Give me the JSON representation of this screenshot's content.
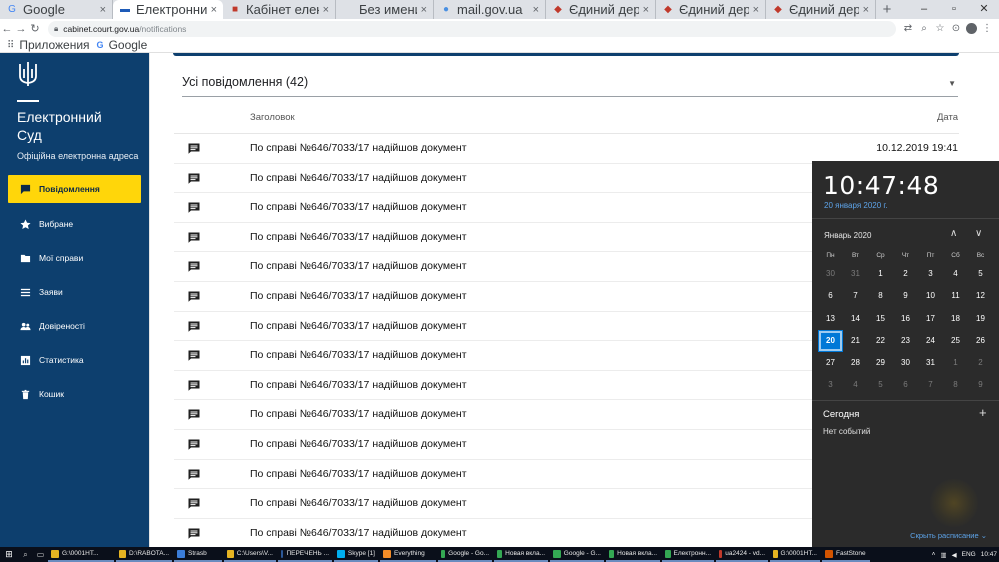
{
  "browser": {
    "tabs": [
      {
        "title": "Google",
        "icon": "google-icon",
        "active": false,
        "width": 113
      },
      {
        "title": "Електронний",
        "icon": "ukraine-flag-icon",
        "active": true,
        "width": 110
      },
      {
        "title": "Кабінет елек",
        "icon": "court-icon",
        "active": false,
        "width": 113
      },
      {
        "title": "Без имени",
        "icon": "blank-icon",
        "active": false,
        "width": 98
      },
      {
        "title": "mail.gov.ua",
        "icon": "mail-icon",
        "active": false,
        "width": 112
      },
      {
        "title": "Єдиний держ",
        "icon": "registry-icon",
        "active": false,
        "width": 110
      },
      {
        "title": "Єдиний держ",
        "icon": "registry-icon",
        "active": false,
        "width": 110
      },
      {
        "title": "Єдиний держ",
        "icon": "registry-icon",
        "active": false,
        "width": 110
      }
    ],
    "new_tab": "+",
    "window_controls": [
      "–",
      "▫",
      "✕"
    ],
    "url_host": "cabinet.court.gov.ua",
    "url_path": "/notifications",
    "bookmarks": [
      {
        "label": "Приложения",
        "icon": "apps-grid-icon"
      },
      {
        "label": "Google",
        "icon": "google-icon"
      }
    ]
  },
  "sidebar": {
    "brand_title_line1": "Електронний",
    "brand_title_line2": "Суд",
    "brand_subtitle": "Офіційна електронна адреса",
    "items": [
      {
        "label": "Повідомлення",
        "icon": "message-icon",
        "active": true
      },
      {
        "label": "Вибране",
        "icon": "star-icon",
        "active": false
      },
      {
        "label": "Мої справи",
        "icon": "folder-icon",
        "active": false
      },
      {
        "label": "Заяви",
        "icon": "list-icon",
        "active": false
      },
      {
        "label": "Довіреності",
        "icon": "people-icon",
        "active": false
      },
      {
        "label": "Статистика",
        "icon": "chart-icon",
        "active": false
      },
      {
        "label": "Кошик",
        "icon": "trash-icon",
        "active": false
      }
    ]
  },
  "main": {
    "filter_label": "Усі повідомлення (42)",
    "col_title": "Заголовок",
    "col_date": "Дата",
    "rows": [
      {
        "title": "По справі №646/7033/17 надійшов документ",
        "date": "10.12.2019 19:41"
      },
      {
        "title": "По справі №646/7033/17 надійшов документ",
        "date": ""
      },
      {
        "title": "По справі №646/7033/17 надійшов документ",
        "date": ""
      },
      {
        "title": "По справі №646/7033/17 надійшов документ",
        "date": ""
      },
      {
        "title": "По справі №646/7033/17 надійшов документ",
        "date": ""
      },
      {
        "title": "По справі №646/7033/17 надійшов документ",
        "date": ""
      },
      {
        "title": "По справі №646/7033/17 надійшов документ",
        "date": ""
      },
      {
        "title": "По справі №646/7033/17 надійшов документ",
        "date": ""
      },
      {
        "title": "По справі №646/7033/17 надійшов документ",
        "date": ""
      },
      {
        "title": "По справі №646/7033/17 надійшов документ",
        "date": ""
      },
      {
        "title": "По справі №646/7033/17 надійшов документ",
        "date": ""
      },
      {
        "title": "По справі №646/7033/17 надійшов документ",
        "date": ""
      },
      {
        "title": "По справі №646/7033/17 надійшов документ",
        "date": ""
      },
      {
        "title": "По справі №646/7033/17 надійшов документ",
        "date": ""
      }
    ]
  },
  "clock": {
    "time": "10:47:48",
    "date": "20 января 2020 г.",
    "month": "Январь 2020",
    "weekdays": [
      "Пн",
      "Вт",
      "Ср",
      "Чт",
      "Пт",
      "Сб",
      "Вс"
    ],
    "weeks": [
      [
        "30",
        "31",
        "1",
        "2",
        "3",
        "4",
        "5"
      ],
      [
        "6",
        "7",
        "8",
        "9",
        "10",
        "11",
        "12"
      ],
      [
        "13",
        "14",
        "15",
        "16",
        "17",
        "18",
        "19"
      ],
      [
        "20",
        "21",
        "22",
        "23",
        "24",
        "25",
        "26"
      ],
      [
        "27",
        "28",
        "29",
        "30",
        "31",
        "1",
        "2"
      ],
      [
        "3",
        "4",
        "5",
        "6",
        "7",
        "8",
        "9"
      ]
    ],
    "dim_flags": [
      [
        1,
        1,
        0,
        0,
        0,
        0,
        0
      ],
      [
        0,
        0,
        0,
        0,
        0,
        0,
        0
      ],
      [
        0,
        0,
        0,
        0,
        0,
        0,
        0
      ],
      [
        0,
        0,
        0,
        0,
        0,
        0,
        0
      ],
      [
        0,
        0,
        0,
        0,
        0,
        1,
        1
      ],
      [
        1,
        1,
        1,
        1,
        1,
        1,
        1
      ]
    ],
    "today_index": [
      3,
      0
    ],
    "today_label": "Сегодня",
    "no_events": "Нет событий",
    "hide_schedule": "Скрыть расписание ⌄"
  },
  "taskbar": {
    "apps": [
      {
        "label": "G:\\0001HT...",
        "color": "#e6b422",
        "width": 66
      },
      {
        "label": "D:\\RABOTA...",
        "color": "#e6b422",
        "width": 56
      },
      {
        "label": "Strasb",
        "color": "#3b7dd8",
        "width": 48
      },
      {
        "label": "C:\\Users\\V...",
        "color": "#e6b422",
        "width": 52
      },
      {
        "label": "ПЕРЕЧЕНЬ ...",
        "color": "#2b5797",
        "width": 54
      },
      {
        "label": "Skype [1]",
        "color": "#00aff0",
        "width": 44
      },
      {
        "label": "Everything",
        "color": "#f28c28",
        "width": 56
      },
      {
        "label": "Google - Go...",
        "color": "#34a853",
        "width": 54
      },
      {
        "label": "Новая вкла...",
        "color": "#34a853",
        "width": 54
      },
      {
        "label": "Google - G...",
        "color": "#34a853",
        "width": 54
      },
      {
        "label": "Новая вкла...",
        "color": "#34a853",
        "width": 54
      },
      {
        "label": "Електронн...",
        "color": "#34a853",
        "width": 52
      },
      {
        "label": "ua2424 - vd...",
        "color": "#c0392b",
        "width": 52
      },
      {
        "label": "G:\\0001HT...",
        "color": "#e6b422",
        "width": 50
      },
      {
        "label": "FastStone",
        "color": "#d35400",
        "width": 48
      }
    ],
    "lang": "ENG",
    "time": "10:47"
  }
}
